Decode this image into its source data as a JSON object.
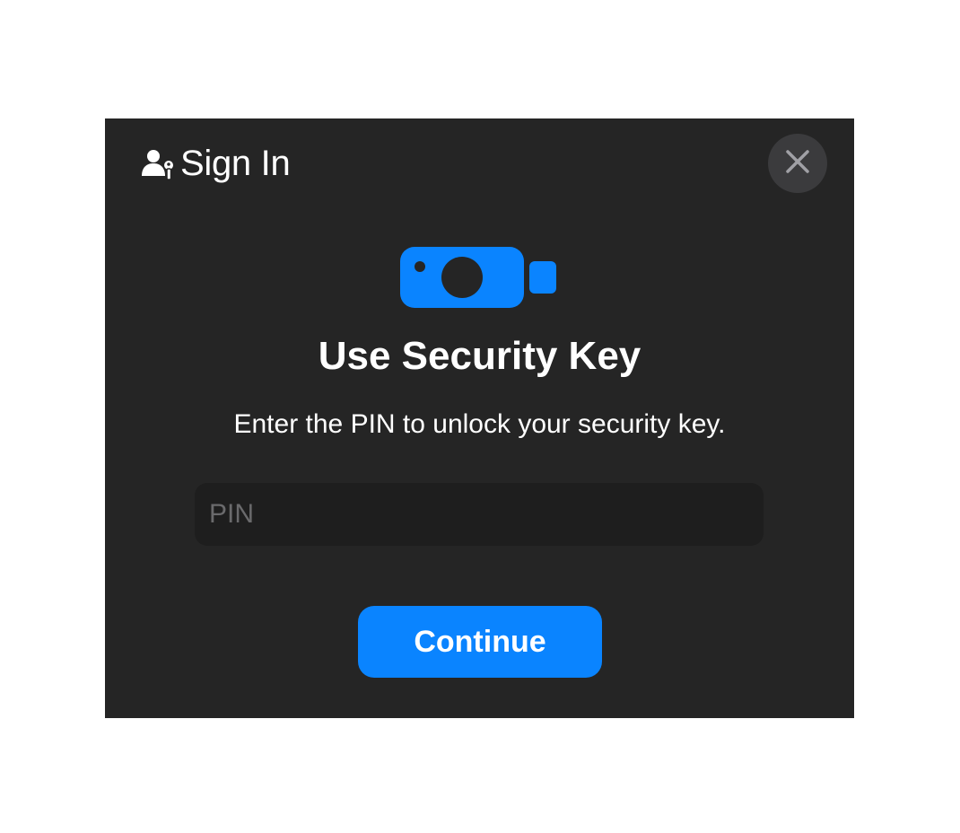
{
  "header": {
    "title": "Sign In",
    "icon": "person-key-icon"
  },
  "close_button": {
    "icon": "close-icon"
  },
  "hero": {
    "icon": "security-key-icon",
    "color": "#0a84ff"
  },
  "main": {
    "heading": "Use Security Key",
    "subtitle": "Enter the PIN to unlock your security key."
  },
  "pin_field": {
    "value": "",
    "placeholder": "PIN"
  },
  "continue_button": {
    "label": "Continue",
    "color": "#0a84ff"
  },
  "colors": {
    "sheet_background": "#252525",
    "text": "#ffffff"
  }
}
